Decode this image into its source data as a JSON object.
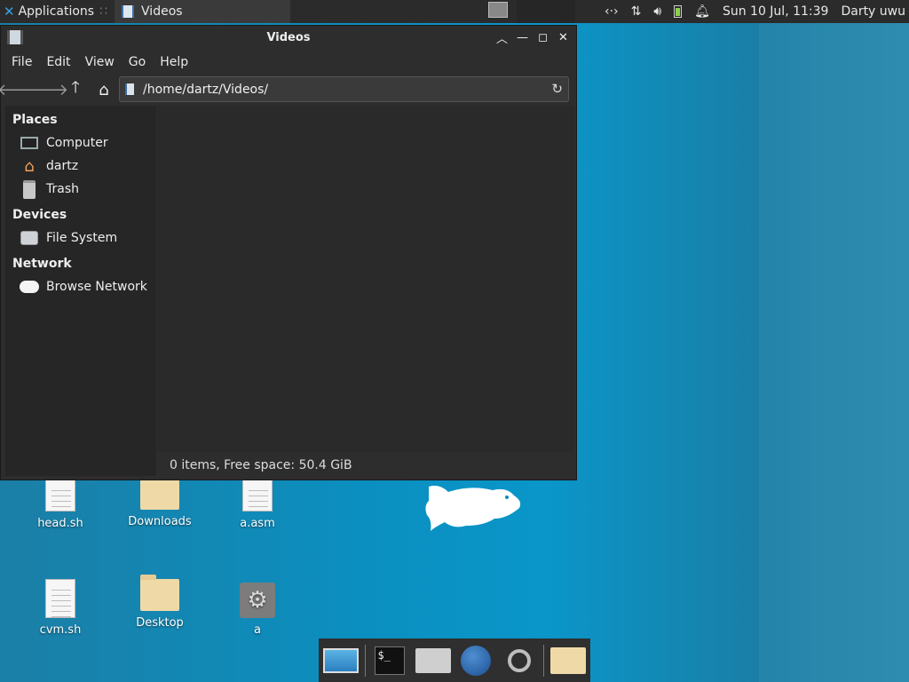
{
  "top_panel": {
    "applications_label": "Applications",
    "applications_sep": "∷",
    "task_title": "Videos",
    "clock": "Sun 10 Jul, 11:39",
    "user": "Darty uwu"
  },
  "window": {
    "title": "Videos",
    "menu": [
      "File",
      "Edit",
      "View",
      "Go",
      "Help"
    ],
    "location": "/home/dartz/Videos/",
    "sidebar": {
      "places_header": "Places",
      "places": [
        "Computer",
        "dartz",
        "Trash"
      ],
      "devices_header": "Devices",
      "devices": [
        "File System"
      ],
      "network_header": "Network",
      "network": [
        "Browse Network"
      ]
    },
    "status": "0 items, Free space: 50.4 GiB"
  },
  "desktop": {
    "icons": [
      "head.sh",
      "Downloads",
      "a.asm",
      "cvm.sh",
      "Desktop",
      "a"
    ]
  },
  "colors": {
    "panel_bg": "#2b2b2b",
    "window_bg": "#2d2d2d",
    "desktop_blue": "#0a96c9"
  }
}
